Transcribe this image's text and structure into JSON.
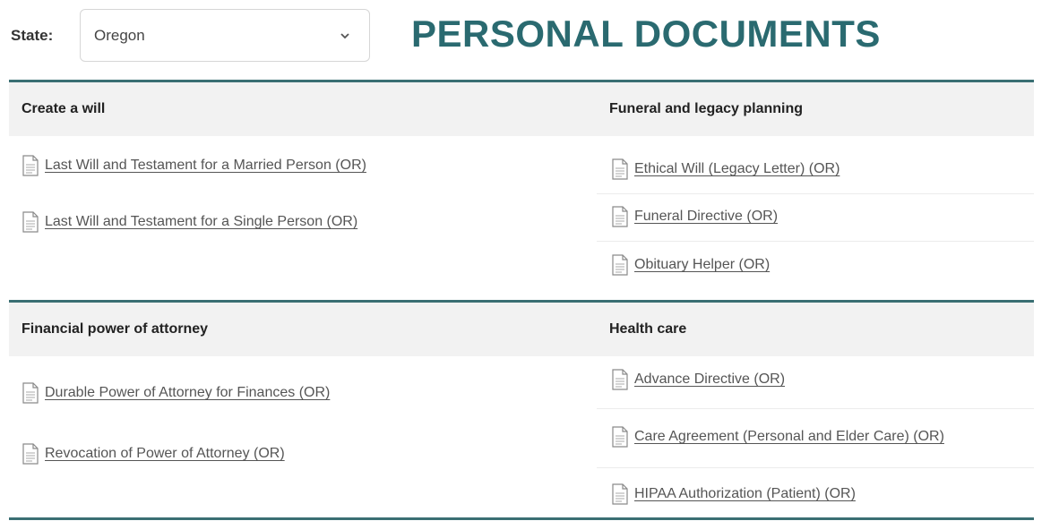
{
  "state_label": "State:",
  "state_select": {
    "value": "Oregon"
  },
  "page_title": "PERSONAL DOCUMENTS",
  "colors": {
    "accent": "#2a6a70",
    "rule": "#3a6f73",
    "header_bg": "#f2f2f2"
  },
  "sections": [
    {
      "title": "Create a will",
      "documents": [
        "Last Will and Testament for a Married Person (OR)",
        "Last Will and Testament for a Single Person (OR)"
      ]
    },
    {
      "title": "Funeral and legacy planning",
      "documents": [
        "Ethical Will (Legacy Letter) (OR)",
        "Funeral Directive (OR)",
        "Obituary Helper (OR)"
      ]
    },
    {
      "title": "Financial power of attorney",
      "documents": [
        "Durable Power of Attorney for Finances (OR)",
        "Revocation of Power of Attorney (OR)"
      ]
    },
    {
      "title": "Health care",
      "documents": [
        "Advance Directive (OR)",
        "Care Agreement (Personal and Elder Care) (OR)",
        "HIPAA Authorization (Patient) (OR)"
      ]
    }
  ]
}
